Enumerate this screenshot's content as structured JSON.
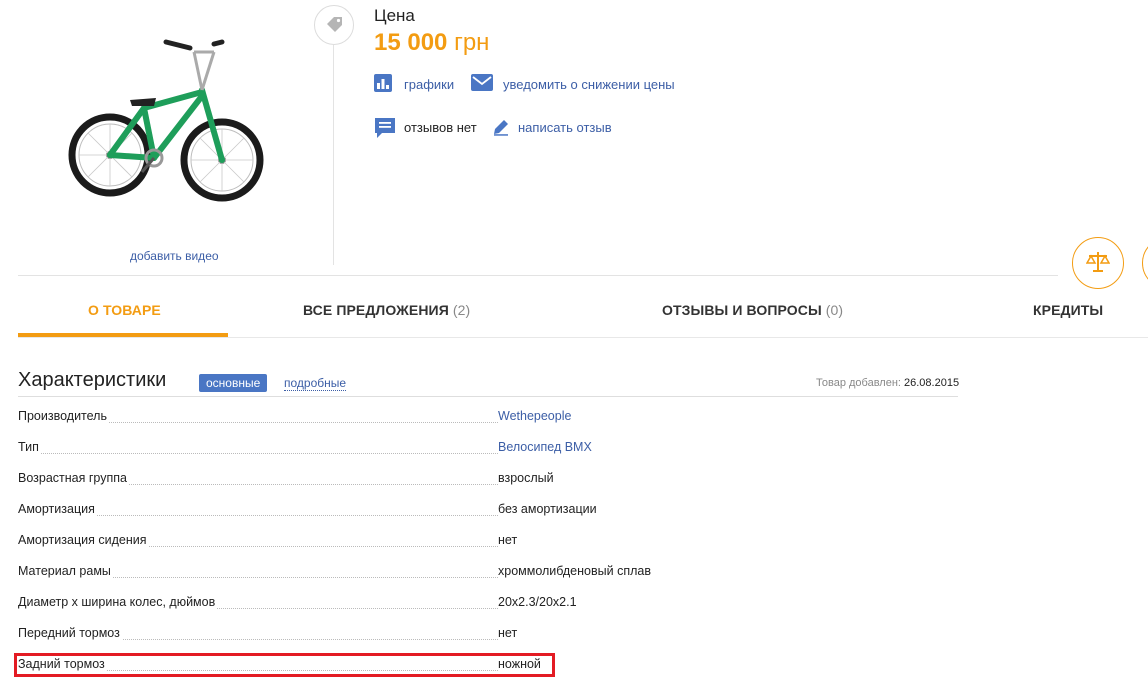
{
  "product": {
    "add_video": "добавить видео"
  },
  "price": {
    "label": "Цена",
    "amount": "15 000",
    "currency": "грн"
  },
  "actions": {
    "charts": "графики",
    "notify": "уведомить о снижении цены",
    "reviews_status": "отзывов нет",
    "write_review": "написать отзыв"
  },
  "tabs": [
    {
      "label": "О ТОВАРЕ",
      "count": ""
    },
    {
      "label": "ВСЕ ПРЕДЛОЖЕНИЯ",
      "count": "(2)"
    },
    {
      "label": "ОТЗЫВЫ И ВОПРОСЫ",
      "count": "(0)"
    },
    {
      "label": "КРЕДИТЫ",
      "count": ""
    }
  ],
  "specs": {
    "title": "Характеристики",
    "basic": "основные",
    "detailed": "подробные",
    "added_label": "Товар добавлен:",
    "added_date": "26.08.2015",
    "rows": [
      {
        "name": "Производитель",
        "value": "Wethepeople"
      },
      {
        "name": "Тип",
        "value": "Велосипед BMX"
      },
      {
        "name": "Возрастная группа",
        "value": "взрослый"
      },
      {
        "name": "Амортизация",
        "value": "без амортизации"
      },
      {
        "name": "Амортизация сидения",
        "value": "нет"
      },
      {
        "name": "Материал рамы",
        "value": "хроммолибденовый сплав"
      },
      {
        "name": "Диаметр x ширина колес, дюймов",
        "value": "20x2.3/20x2.1"
      },
      {
        "name": "Передний тормоз",
        "value": "нет"
      },
      {
        "name": "Задний тормоз",
        "value": "ножной"
      }
    ]
  },
  "colors": {
    "accent": "#f39c12",
    "link": "#3c5ea6",
    "highlight": "#e31b23",
    "badge": "#4a76c4",
    "bike_frame": "#1e9e5a"
  }
}
